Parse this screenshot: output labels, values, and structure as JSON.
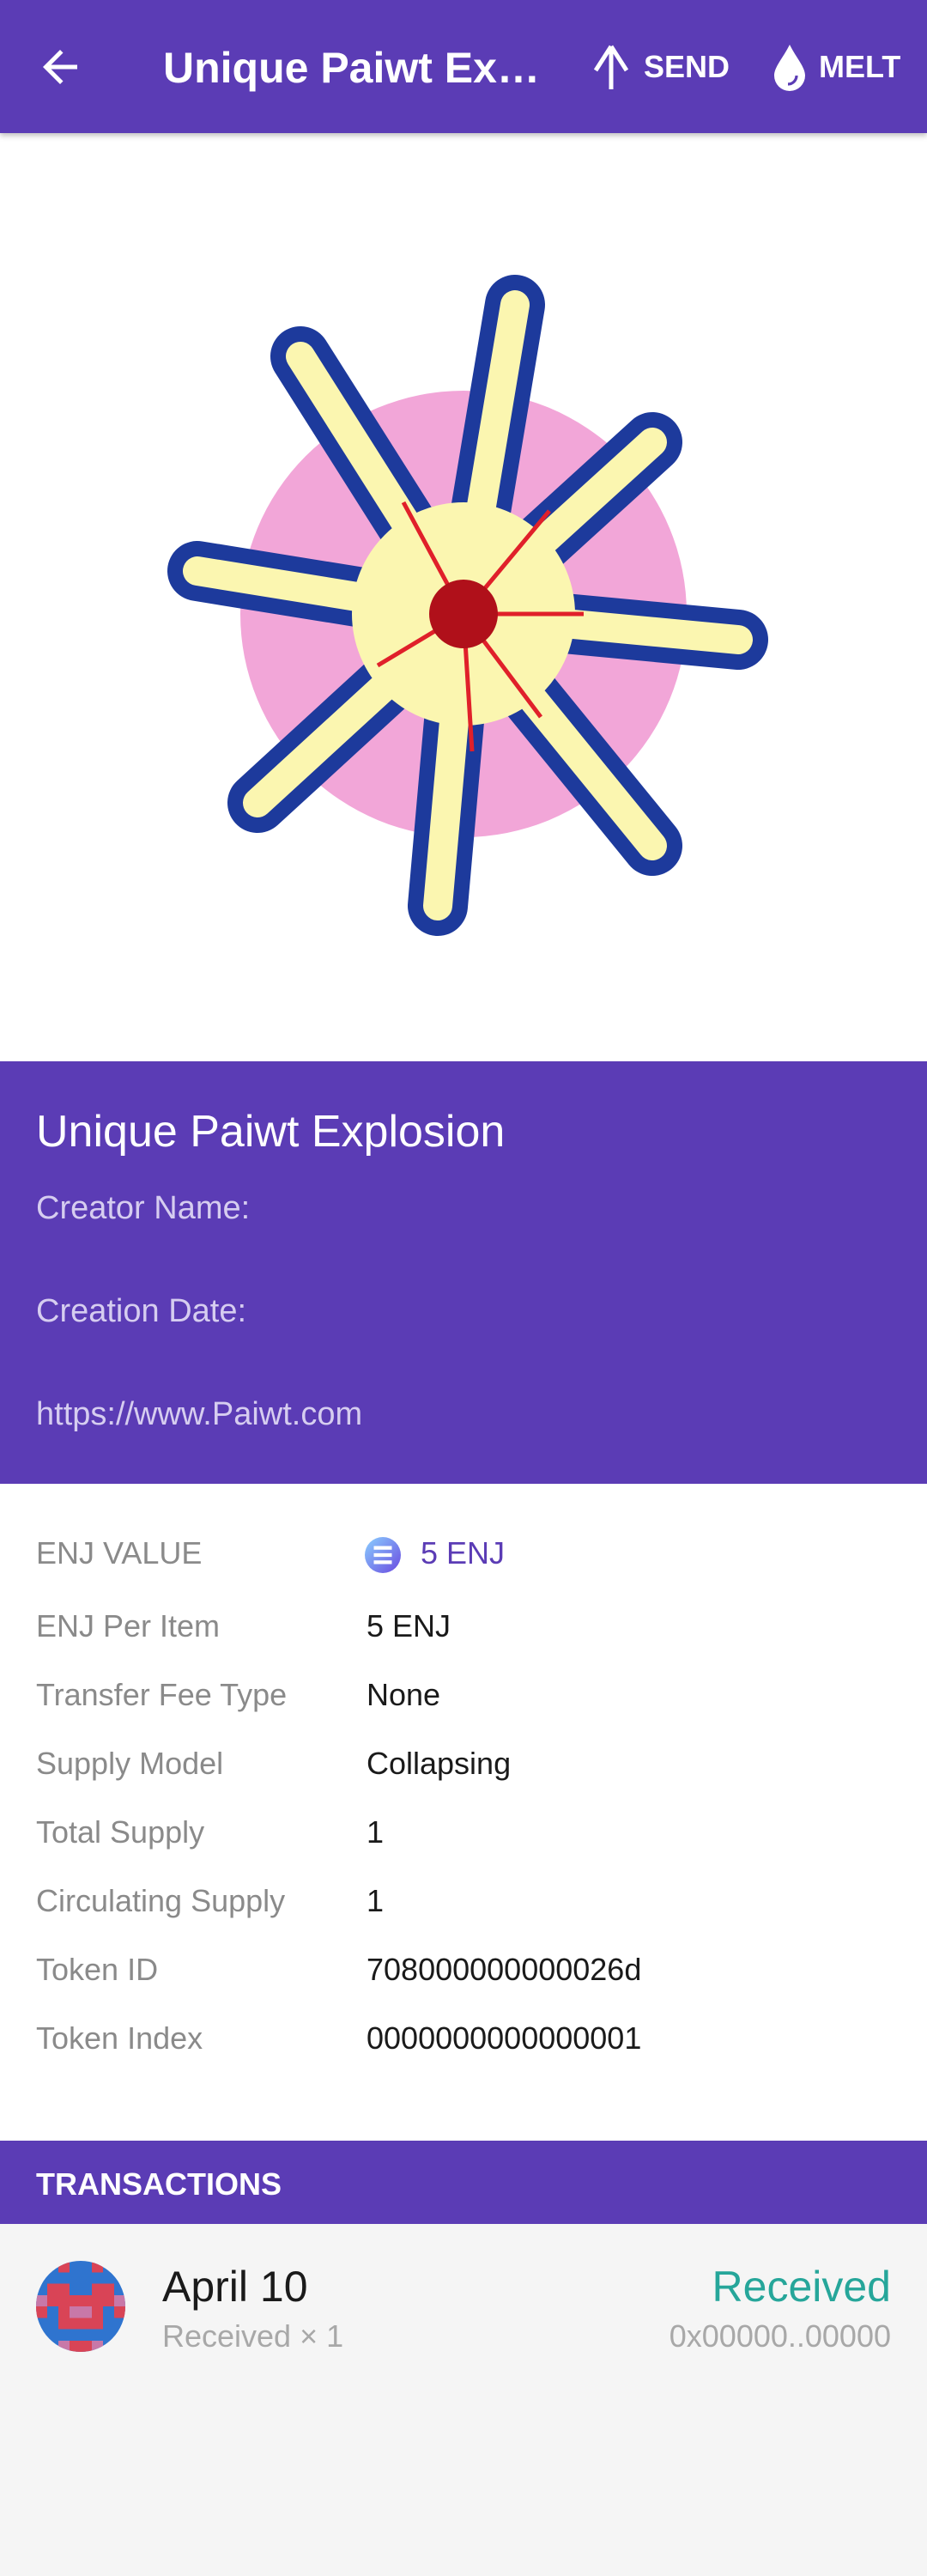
{
  "appbar": {
    "title": "Unique Paiwt Explosion",
    "send_label": "SEND",
    "melt_label": "MELT"
  },
  "item": {
    "name": "Unique Paiwt Explosion",
    "creator_label": "Creator Name:",
    "date_label": "Creation Date:",
    "url": "https://www.Paiwt.com"
  },
  "details": [
    {
      "label": "ENJ VALUE",
      "value": "5 ENJ"
    },
    {
      "label": "ENJ Per Item",
      "value": "5 ENJ"
    },
    {
      "label": "Transfer Fee Type",
      "value": "None"
    },
    {
      "label": "Supply Model",
      "value": "Collapsing"
    },
    {
      "label": "Total Supply",
      "value": "1"
    },
    {
      "label": "Circulating Supply",
      "value": "1"
    },
    {
      "label": "Token ID",
      "value": "708000000000026d"
    },
    {
      "label": "Token Index",
      "value": "0000000000000001"
    }
  ],
  "transactions": {
    "header": "TRANSACTIONS",
    "items": [
      {
        "date": "April 10",
        "summary": "Received × 1",
        "status": "Received",
        "address": "0x00000..00000"
      }
    ]
  },
  "colors": {
    "primary": "#5b3cb5",
    "received": "#26a69a"
  }
}
